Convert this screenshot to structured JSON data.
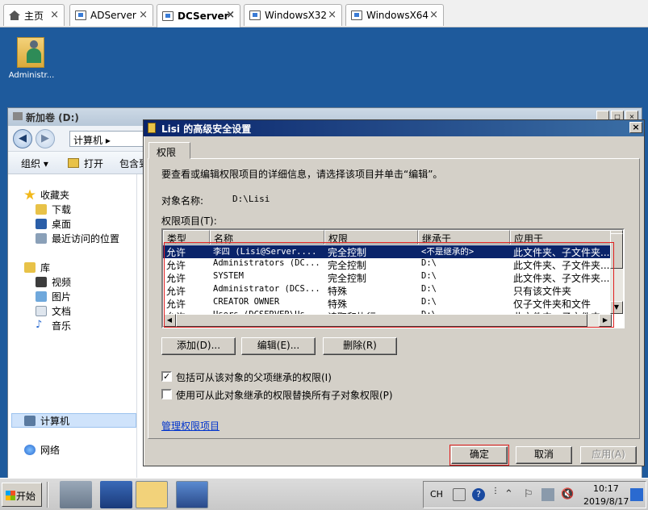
{
  "tabs": [
    {
      "label": "主页",
      "active": false
    },
    {
      "label": "ADServer",
      "active": false
    },
    {
      "label": "DCServer",
      "active": true
    },
    {
      "label": "WindowsX32",
      "active": false
    },
    {
      "label": "WindowsX64",
      "active": false
    }
  ],
  "tab_close": "×",
  "desktop": {
    "icon_label": "Administr..."
  },
  "explorer": {
    "title": "新加卷 (D:)",
    "address": "计算机 ▸",
    "toolbar": {
      "organize": "组织 ▾",
      "open": "打开",
      "include": "包含到"
    },
    "nav": {
      "favorites": "收藏夹",
      "downloads": "下载",
      "desktop": "桌面",
      "recent": "最近访问的位置",
      "libraries": "库",
      "videos": "视频",
      "pictures": "图片",
      "documents": "文档",
      "music": "音乐",
      "computer": "计算机",
      "network": "网络"
    }
  },
  "dialog": {
    "title": "Lisi 的高级安全设置",
    "close": "×",
    "tab": "权限",
    "instruction": "要查看或编辑权限项目的详细信息，请选择该项目并单击“编辑”。",
    "object_name_label": "对象名称:",
    "object_name_value": "D:\\Lisi",
    "entries_label": "权限项目(T):",
    "columns": [
      "类型",
      "名称",
      "权限",
      "继承于",
      "应用于"
    ],
    "rows": [
      {
        "type": "允许",
        "name": "李四 (Lisi@Server....",
        "perm": "完全控制",
        "inherit": "<不是继承的>",
        "apply": "此文件夹、子文件夹...",
        "selected": true
      },
      {
        "type": "允许",
        "name": "Administrators (DC...",
        "perm": "完全控制",
        "inherit": "D:\\",
        "apply": "此文件夹、子文件夹...",
        "selected": false
      },
      {
        "type": "允许",
        "name": "SYSTEM",
        "perm": "完全控制",
        "inherit": "D:\\",
        "apply": "此文件夹、子文件夹...",
        "selected": false
      },
      {
        "type": "允许",
        "name": "Administrator (DCS...",
        "perm": "特殊",
        "inherit": "D:\\",
        "apply": "只有该文件夹",
        "selected": false
      },
      {
        "type": "允许",
        "name": "CREATOR OWNER",
        "perm": "特殊",
        "inherit": "D:\\",
        "apply": "仅子文件夹和文件",
        "selected": false
      },
      {
        "type": "允许",
        "name": "Users (DCSERVER\\Us...",
        "perm": "读取和执行",
        "inherit": "D:\\",
        "apply": "此文件夹、子文件夹...",
        "selected": false
      }
    ],
    "buttons": {
      "add": "添加(D)...",
      "edit": "编辑(E)...",
      "remove": "删除(R)"
    },
    "checkbox_inherit": {
      "label": "包括可从该对象的父项继承的权限(I)",
      "checked": true
    },
    "checkbox_replace": {
      "label": "使用可从此对象继承的权限替换所有子对象权限(P)",
      "checked": false
    },
    "manage_link": "管理权限项目",
    "footer": {
      "ok": "确定",
      "cancel": "取消",
      "apply": "应用(A)"
    }
  },
  "taskbar": {
    "start": "开始",
    "lang": "CH",
    "time": "10:17",
    "date": "2019/8/17"
  }
}
